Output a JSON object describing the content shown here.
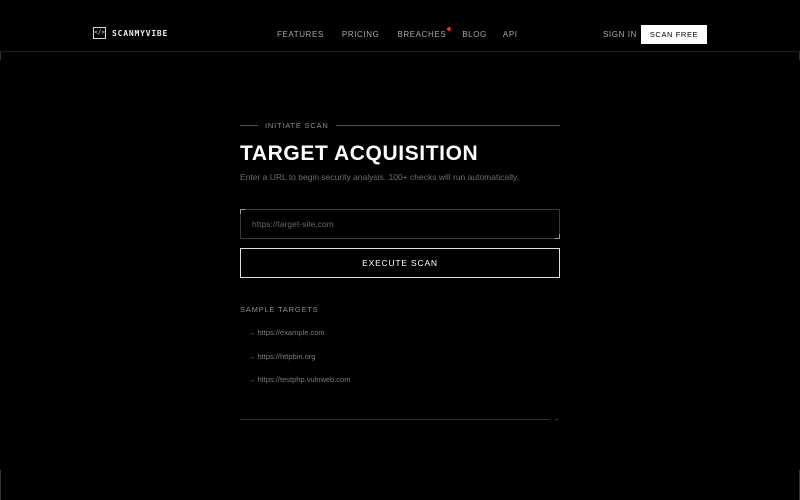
{
  "nav": {
    "brand_icon": "</>",
    "brand_name": "SCANMYVIBE",
    "links": [
      {
        "label": "FEATURES"
      },
      {
        "label": "PRICING"
      },
      {
        "label": "BREACHES",
        "has_notification": true
      },
      {
        "label": "BLOG"
      },
      {
        "label": "API"
      }
    ],
    "sign_in": "SIGN IN",
    "cta": "SCAN FREE"
  },
  "main": {
    "eyebrow": "INITIATE SCAN",
    "title": "TARGET ACQUISITION",
    "subtitle": "Enter a URL to begin security analysis. 100+ checks will run automatically.",
    "input": {
      "placeholder": "https://target-site.com",
      "value": ""
    },
    "execute_label": "EXECUTE SCAN",
    "samples_heading": "SAMPLE TARGETS",
    "samples": [
      {
        "arrow": "→",
        "url": "https://example.com"
      },
      {
        "arrow": "→",
        "url": "https://httpbin.org"
      },
      {
        "arrow": "→",
        "url": "https://testphp.vulnweb.com"
      }
    ]
  },
  "colors": {
    "background": "#000000",
    "notification_dot": "#e03030",
    "cta_bg": "#ffffff"
  },
  "icons": {
    "brand": "code-brackets-icon",
    "notification": "notification-dot-icon",
    "sample_arrow": "arrow-right-icon"
  }
}
